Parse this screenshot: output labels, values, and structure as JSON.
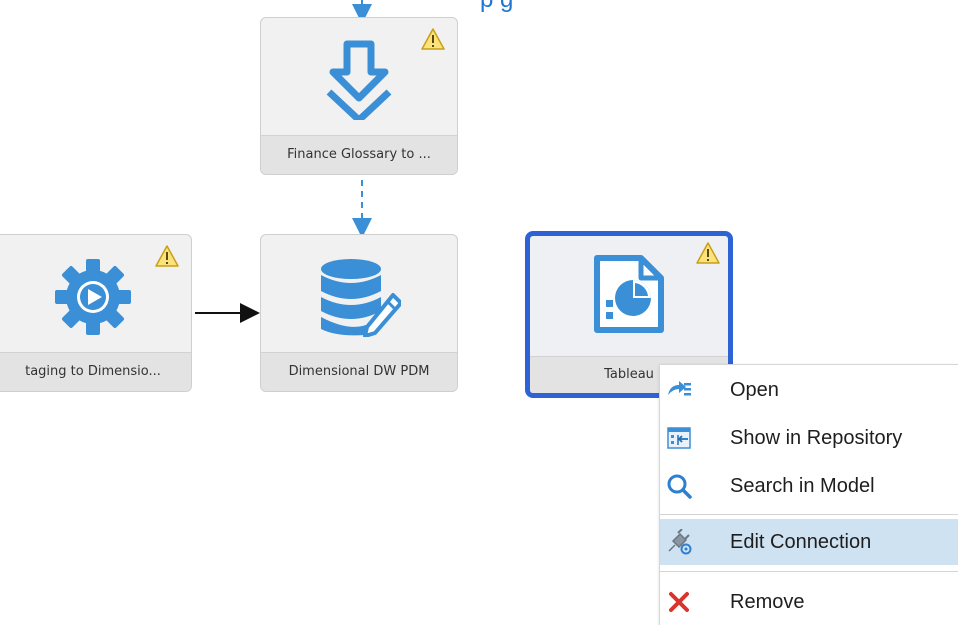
{
  "canvas": {
    "top_label_fragment": "p g"
  },
  "nodes": [
    {
      "id": "finance-glossary",
      "label": "Finance Glossary to ...",
      "icon": "download-arrow-icon",
      "warning": true,
      "selected": false
    },
    {
      "id": "staging-to-dimensional",
      "label": "taging to Dimensio...",
      "icon": "gear-play-icon",
      "warning": true,
      "selected": false
    },
    {
      "id": "dimensional-dw-pdm",
      "label": "Dimensional DW PDM",
      "icon": "database-edit-icon",
      "warning": false,
      "selected": false
    },
    {
      "id": "tableau",
      "label": "Tableau",
      "icon": "report-pie-icon",
      "warning": true,
      "selected": true
    }
  ],
  "context_menu": {
    "items": [
      {
        "label": "Open",
        "icon": "open-icon"
      },
      {
        "label": "Show in Repository",
        "icon": "repository-icon"
      },
      {
        "label": "Search in Model",
        "icon": "search-icon"
      },
      {
        "label": "Edit Connection",
        "icon": "edit-connection-icon",
        "highlighted": true
      },
      {
        "label": "Remove",
        "icon": "remove-icon"
      }
    ]
  },
  "colors": {
    "accent_blue": "#2d63d4",
    "icon_blue": "#3a8fd6",
    "warning_yellow": "#f3c623",
    "remove_red": "#d9342b",
    "menu_highlight": "#cfe2f2"
  }
}
